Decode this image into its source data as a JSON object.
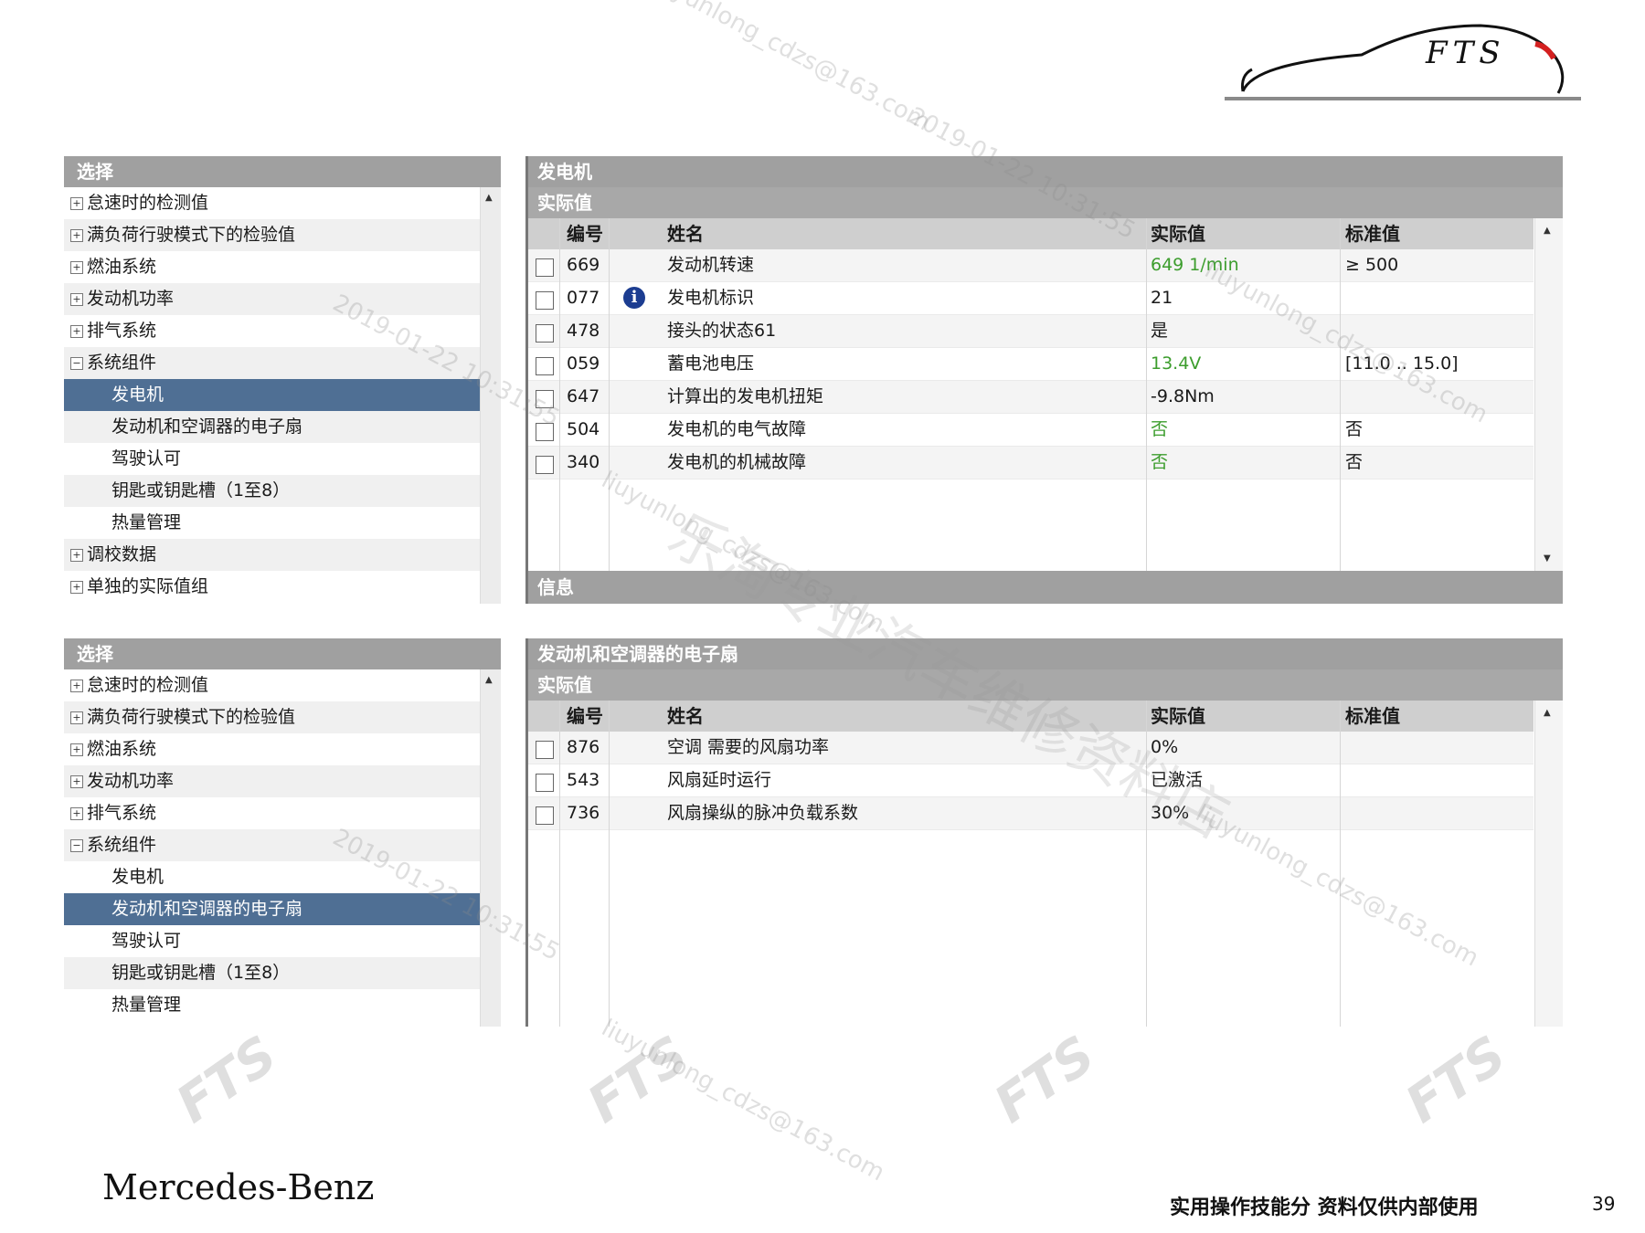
{
  "logo": {
    "text": "FTS"
  },
  "panel1": {
    "left_title": "选择",
    "tree": [
      {
        "label": "怠速时的检测值",
        "level": 0,
        "expander": "+"
      },
      {
        "label": "满负荷行驶模式下的检验值",
        "level": 0,
        "expander": "+"
      },
      {
        "label": "燃油系统",
        "level": 0,
        "expander": "+"
      },
      {
        "label": "发动机功率",
        "level": 0,
        "expander": "+"
      },
      {
        "label": "排气系统",
        "level": 0,
        "expander": "+"
      },
      {
        "label": "系统组件",
        "level": 0,
        "expander": "−"
      },
      {
        "label": "发电机",
        "level": 1,
        "selected": true
      },
      {
        "label": "发动机和空调器的电子扇",
        "level": 1
      },
      {
        "label": "驾驶认可",
        "level": 1
      },
      {
        "label": "钥匙或钥匙槽（1至8）",
        "level": 1
      },
      {
        "label": "热量管理",
        "level": 1
      },
      {
        "label": "调校数据",
        "level": 0,
        "expander": "+"
      },
      {
        "label": "单独的实际值组",
        "level": 0,
        "expander": "+"
      }
    ],
    "right_title": "发电机",
    "subtitle": "实际值",
    "columns": {
      "id": "编号",
      "name": "姓名",
      "actual": "实际值",
      "standard": "标准值"
    },
    "rows": [
      {
        "id": "669",
        "name": "发动机转速",
        "actual": "649 1/min",
        "standard": "≥ 500",
        "green": true
      },
      {
        "id": "077",
        "name": "发电机标识",
        "actual": "21",
        "standard": "",
        "info": true
      },
      {
        "id": "478",
        "name": "接头的状态61",
        "actual": "是",
        "standard": ""
      },
      {
        "id": "059",
        "name": "蓄电池电压",
        "actual": "13.4V",
        "standard": "[11.0 .. 15.0]",
        "green": true
      },
      {
        "id": "647",
        "name": "计算出的发电机扭矩",
        "actual": "-9.8Nm",
        "standard": ""
      },
      {
        "id": "504",
        "name": "发电机的电气故障",
        "actual": "否",
        "standard": "否",
        "green": true
      },
      {
        "id": "340",
        "name": "发电机的机械故障",
        "actual": "否",
        "standard": "否",
        "green": true
      }
    ],
    "info_label": "信息"
  },
  "panel2": {
    "left_title": "选择",
    "tree": [
      {
        "label": "怠速时的检测值",
        "level": 0,
        "expander": "+"
      },
      {
        "label": "满负荷行驶模式下的检验值",
        "level": 0,
        "expander": "+"
      },
      {
        "label": "燃油系统",
        "level": 0,
        "expander": "+"
      },
      {
        "label": "发动机功率",
        "level": 0,
        "expander": "+"
      },
      {
        "label": "排气系统",
        "level": 0,
        "expander": "+"
      },
      {
        "label": "系统组件",
        "level": 0,
        "expander": "−"
      },
      {
        "label": "发电机",
        "level": 1
      },
      {
        "label": "发动机和空调器的电子扇",
        "level": 1,
        "selected": true
      },
      {
        "label": "驾驶认可",
        "level": 1
      },
      {
        "label": "钥匙或钥匙槽（1至8）",
        "level": 1
      },
      {
        "label": "热量管理",
        "level": 1
      }
    ],
    "right_title": "发动机和空调器的电子扇",
    "subtitle": "实际值",
    "columns": {
      "id": "编号",
      "name": "姓名",
      "actual": "实际值",
      "standard": "标准值"
    },
    "rows": [
      {
        "id": "876",
        "name": "空调 需要的风扇功率",
        "actual": "0%",
        "standard": ""
      },
      {
        "id": "543",
        "name": "风扇延时运行",
        "actual": "已激活",
        "standard": ""
      },
      {
        "id": "736",
        "name": "风扇操纵的脉冲负载系数",
        "actual": "30%",
        "standard": ""
      }
    ]
  },
  "footer": {
    "brand": "Mercedes-Benz",
    "note": "实用操作技能分 资料仅供内部使用",
    "page": "39"
  },
  "watermarks": {
    "email": "liuyunlong_cdzs@163.com",
    "timestamp": "2019-01-22 10:31:55",
    "shop": "乐淘专业汽车维修资料店",
    "fts": "FTS"
  },
  "colors": {
    "header_gray": "#a0a0a0",
    "selected_blue": "#4f6f94",
    "value_green": "#3c9d2d",
    "info_icon_blue": "#1c3d91"
  }
}
